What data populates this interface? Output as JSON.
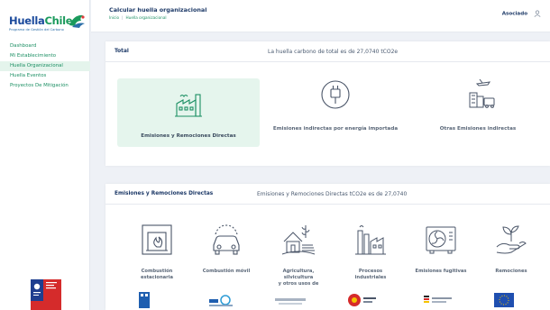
{
  "brand": {
    "name_part1": "Huella",
    "name_part2": "Chile",
    "subtitle": "Programa de Gestión del Carbono"
  },
  "sidebar": {
    "items": [
      {
        "label": "Dashboard",
        "active": false
      },
      {
        "label": "Mi Establecimiento",
        "active": false
      },
      {
        "label": "Huella Organizacional",
        "active": true
      },
      {
        "label": "Huella Eventos",
        "active": false
      },
      {
        "label": "Proyectos De Mitigación",
        "active": false
      }
    ]
  },
  "header": {
    "title": "Calcular huella organizacional",
    "breadcrumb": [
      "Inicio",
      "Huella organizacional"
    ],
    "user_label": "Asociado"
  },
  "total_card": {
    "title": "Total",
    "summary": "La huella carbono de total es de 27,0740 tCO2e",
    "tiles": [
      {
        "label": "Emisiones y Remociones Directas",
        "selected": true
      },
      {
        "label": "Emisiones indirectas por energía importada",
        "selected": false
      },
      {
        "label": "Otras Emisiones indirectas",
        "selected": false
      }
    ]
  },
  "emissions_card": {
    "title": "Emisiones y Remociones Directas",
    "summary": "Emisiones y Remociones Directas tCO2e es de 27,0740",
    "tiles": [
      {
        "label_line1": "Combustión",
        "label_line2": "estacionaria",
        "label_line3": ""
      },
      {
        "label_line1": "Combustión móvil",
        "label_line2": "",
        "label_line3": ""
      },
      {
        "label_line1": "Agricultura,",
        "label_line2": "silvicultura",
        "label_line3": "y otros usos de"
      },
      {
        "label_line1": "Procesos",
        "label_line2": "industriales",
        "label_line3": ""
      },
      {
        "label_line1": "Emisiones fugitivas",
        "label_line2": "",
        "label_line3": ""
      },
      {
        "label_line1": "Remociones",
        "label_line2": "",
        "label_line3": ""
      }
    ]
  },
  "colors": {
    "accent_green": "#1b8f63",
    "brand_blue": "#1b4a9c",
    "selected_bg": "#e5f5ed",
    "background": "#eef1f6"
  },
  "icons": {
    "logo_mark": "chile-map-icon",
    "user": "user-icon",
    "total_tiles": [
      "factory-icon",
      "plug-icon",
      "city-transport-icon"
    ],
    "emission_tiles": [
      "fireplace-icon",
      "car-icon",
      "farm-icon",
      "industry-icon",
      "fan-unit-icon",
      "plant-hand-icon"
    ]
  }
}
